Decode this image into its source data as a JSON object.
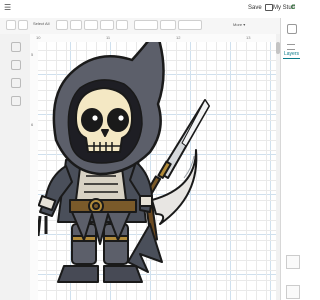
{
  "header": {
    "save_label": "Save",
    "mystuff_label": "My Stuff",
    "menu_label": "☰",
    "app_label": "C"
  },
  "toolbar": {
    "select_all_label": "Select All",
    "more_label": "More ▾"
  },
  "rulers": {
    "h_marks": [
      "10",
      "11",
      "12",
      "13"
    ],
    "v_marks": [
      "5",
      "6"
    ]
  },
  "right_panel": {
    "layers_tab": "Layers"
  },
  "colors": {
    "accent": "#0a7a8a",
    "grid_minor": "#e9e9e9",
    "grid_major": "#cfe0ee"
  },
  "canvas_image": {
    "subject": "chibi hooded skeleton reaper with sword and scythe"
  }
}
